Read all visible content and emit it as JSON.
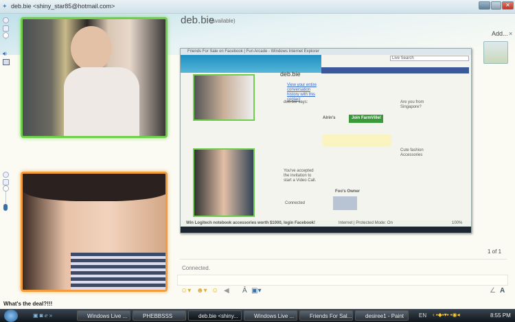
{
  "window": {
    "title": "deb.bie <shiny_star85@hotmail.com>"
  },
  "contact": {
    "name": "deb.bie",
    "status": "(Available)"
  },
  "sidebar": {
    "add_label": "Add...",
    "close": "×"
  },
  "pager": "1 of 1",
  "conversation": {
    "status": "Connected.",
    "input_value": ""
  },
  "personal_message": "What's the deal?!!!",
  "embedded": {
    "ie_title": "Friends For Sale on Facebook | Fun Arcade - Windows Internet Explorer",
    "search_placeholder": "Live Search",
    "chat_name": "deb.bie",
    "chat_lines": [
      "View your entire conversation history with this contact",
      "deb.bie says:",
      "Join FarmVille!",
      "Alrin's",
      "Foo's Owner",
      "Are you from Singapore?",
      "Cute fashion Accessories",
      "You've accepted the invitation to start a Video Call.",
      "Connected"
    ],
    "status_bar": "Internet | Protected Mode: On",
    "zoom": "100%",
    "bottom_ad": "Win Logitech notebook accessories worth $1000, login Facebook!"
  },
  "taskbar": {
    "items": [
      "Windows Live ...",
      "PHEBBSSS",
      "deb.bie <shiny...",
      "Windows Live ...",
      "Friends For Sal...",
      "desiree1 - Paint"
    ],
    "lang": "EN",
    "clock": "8:55 PM"
  }
}
